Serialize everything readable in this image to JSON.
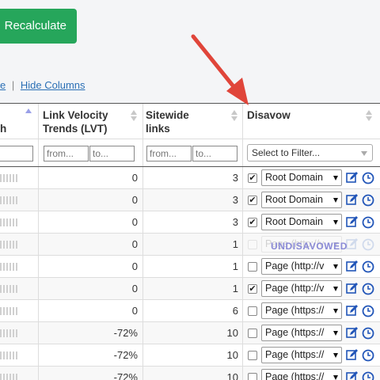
{
  "toolbar": {
    "recalculate_label": "Recalculate"
  },
  "links": {
    "partial_left": "e",
    "separator": "|",
    "hide_columns": "Hide Columns"
  },
  "columns": {
    "partial_first": "h",
    "lvt_line1": "Link Velocity",
    "lvt_line2": "Trends (LVT)",
    "sitewide_line1": "Sitewide",
    "sitewide_line2": "links",
    "disavow": "Disavow"
  },
  "filters": {
    "from_placeholder": "from...",
    "to_placeholder": "to...",
    "disavow_filter": "Select to Filter..."
  },
  "rows": [
    {
      "lvt": "0",
      "sitewide": "3",
      "checked": "✔",
      "option": "Root Domain",
      "state": "normal"
    },
    {
      "lvt": "0",
      "sitewide": "3",
      "checked": "✔",
      "option": "Root Domain",
      "state": "normal"
    },
    {
      "lvt": "0",
      "sitewide": "3",
      "checked": "✔",
      "option": "Root Domain",
      "state": "normal"
    },
    {
      "lvt": "0",
      "sitewide": "1",
      "checked": "",
      "option": "Page (http://v",
      "state": "undisavowed",
      "badge": "UNDISAVOWED"
    },
    {
      "lvt": "0",
      "sitewide": "1",
      "checked": "",
      "option": "Page (http://v",
      "state": "normal"
    },
    {
      "lvt": "0",
      "sitewide": "1",
      "checked": "✔",
      "option": "Page (http://v",
      "state": "normal"
    },
    {
      "lvt": "0",
      "sitewide": "6",
      "checked": "",
      "option": "Page (https://",
      "state": "normal"
    },
    {
      "lvt": "-72%",
      "sitewide": "10",
      "checked": "",
      "option": "Page (https://",
      "state": "normal"
    },
    {
      "lvt": "-72%",
      "sitewide": "10",
      "checked": "",
      "option": "Page (https://",
      "state": "normal"
    },
    {
      "lvt": "-72%",
      "sitewide": "10",
      "checked": "",
      "option": "Page (https://",
      "state": "normal"
    }
  ],
  "colors": {
    "accent_green": "#26a65b",
    "link_blue": "#2a6fb5",
    "annotation_red": "#e0453a",
    "icon_blue": "#2155b8"
  },
  "icons": {
    "edit": "edit-icon",
    "history": "history-icon",
    "sort": "sort-arrows-icon",
    "arrow": "annotation-arrow-icon"
  }
}
